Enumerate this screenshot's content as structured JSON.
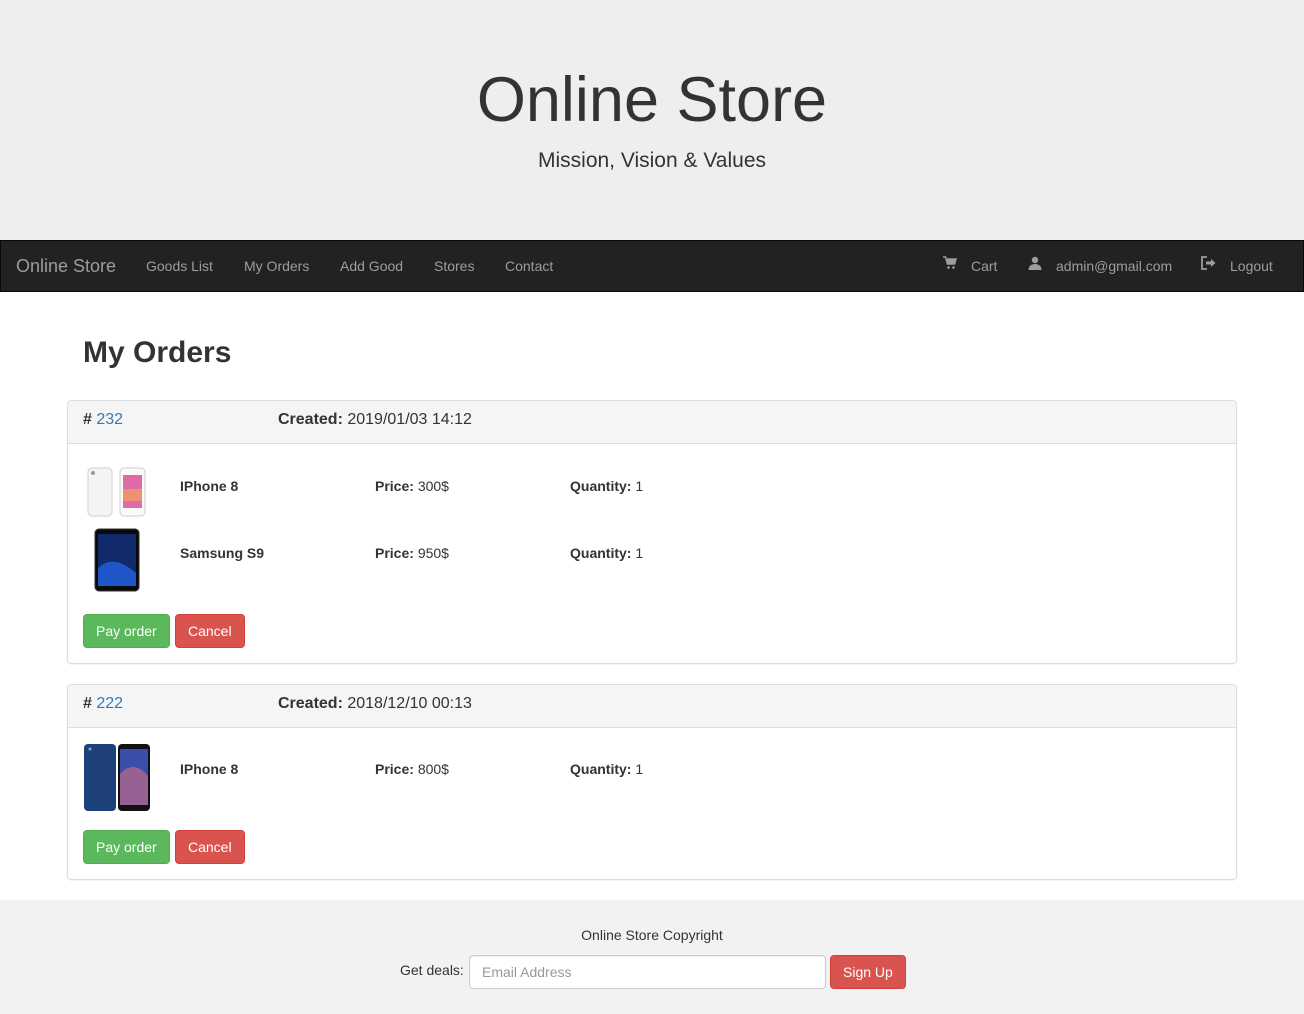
{
  "jumbotron": {
    "title": "Online Store",
    "subtitle": "Mission, Vision & Values"
  },
  "navbar": {
    "brand": "Online Store",
    "links": [
      "Goods List",
      "My Orders",
      "Add Good",
      "Stores",
      "Contact"
    ],
    "cart": "Cart",
    "user": "admin@gmail.com",
    "logout": "Logout",
    "icons": {
      "cart": "shopping-cart-icon",
      "user": "user-icon",
      "logout": "log-out-icon"
    }
  },
  "page_title": "My Orders",
  "orders": [
    {
      "hash": "#",
      "number": "232",
      "created_label": "Created:",
      "created": "2019/01/03 14:12",
      "items": [
        {
          "name": "IPhone 8",
          "price_label": "Price:",
          "price": "300$",
          "qty_label": "Quantity:",
          "qty": "1"
        },
        {
          "name": "Samsung S9",
          "price_label": "Price:",
          "price": "950$",
          "qty_label": "Quantity:",
          "qty": "1"
        }
      ],
      "pay_label": "Pay order",
      "cancel_label": "Cancel"
    },
    {
      "hash": "#",
      "number": "222",
      "created_label": "Created:",
      "created": "2018/12/10 00:13",
      "items": [
        {
          "name": "IPhone 8",
          "price_label": "Price:",
          "price": "800$",
          "qty_label": "Quantity:",
          "qty": "1"
        }
      ],
      "pay_label": "Pay order",
      "cancel_label": "Cancel"
    }
  ],
  "footer": {
    "copyright": "Online Store Copyright",
    "deals_label": "Get deals:",
    "email_placeholder": "Email Address",
    "signup_label": "Sign Up"
  },
  "colors": {
    "success": "#5cb85c",
    "danger": "#d9534f",
    "link": "#337ab7",
    "navbar": "#222222",
    "jumbotron": "#eeeeee"
  }
}
